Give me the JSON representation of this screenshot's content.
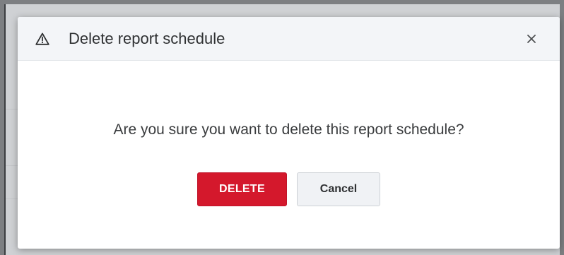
{
  "dialog": {
    "title": "Delete report schedule",
    "message": "Are you sure you want to delete this report schedule?",
    "delete_label": "DELETE",
    "cancel_label": "Cancel",
    "header_icon": "warning-triangle-icon",
    "close_icon": "close-icon"
  },
  "colors": {
    "danger": "#d4182c",
    "header_bg": "#f3f5f8",
    "overlay": "#7d7f82"
  }
}
